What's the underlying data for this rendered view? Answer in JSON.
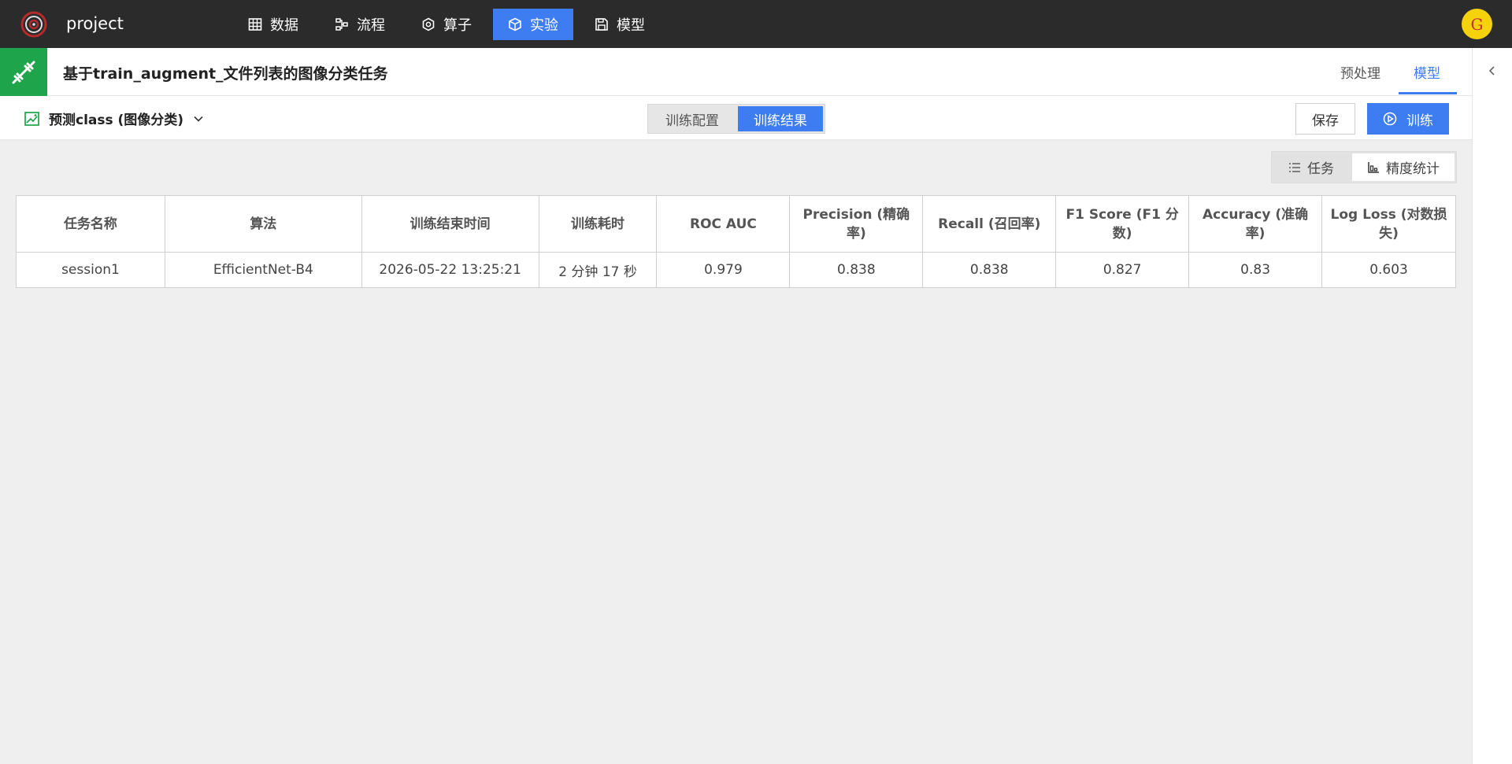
{
  "app": {
    "project": "project",
    "avatar_letter": "G",
    "nav": [
      {
        "label": "数据",
        "icon": "table-icon"
      },
      {
        "label": "流程",
        "icon": "flow-icon"
      },
      {
        "label": "算子",
        "icon": "hexagon-icon"
      },
      {
        "label": "实验",
        "icon": "cube-icon",
        "active": true
      },
      {
        "label": "模型",
        "icon": "save-icon"
      }
    ]
  },
  "titlebar": {
    "title": "基于train_augment_文件列表的图像分类任务",
    "tabs": [
      "预处理",
      "模型"
    ],
    "active_tab": "模型"
  },
  "subbar": {
    "predict_label": "预测class (图像分类)",
    "segments": [
      "训练配置",
      "训练结果"
    ],
    "active_segment": "训练结果",
    "save_label": "保存",
    "train_label": "训练"
  },
  "view_toggle": {
    "task_label": "任务",
    "stats_label": "精度统计"
  },
  "table": {
    "headers": [
      "任务名称",
      "算法",
      "训练结束时间",
      "训练耗时",
      "ROC AUC",
      "Precision (精确率)",
      "Recall (召回率)",
      "F1 Score (F1 分数)",
      "Accuracy (准确率)",
      "Log Loss (对数损失)"
    ],
    "rows": [
      [
        "session1",
        "EfficientNet-B4",
        "2026-05-22 13:25:21",
        "2 分钟 17 秒",
        "0.979",
        "0.838",
        "0.838",
        "0.827",
        "0.83",
        "0.603"
      ]
    ]
  },
  "colors": {
    "accent": "#3d7cf1",
    "topbar": "#2b2b2b",
    "title_icon_bg": "#1ea44a",
    "avatar_bg": "#f5d20b"
  }
}
